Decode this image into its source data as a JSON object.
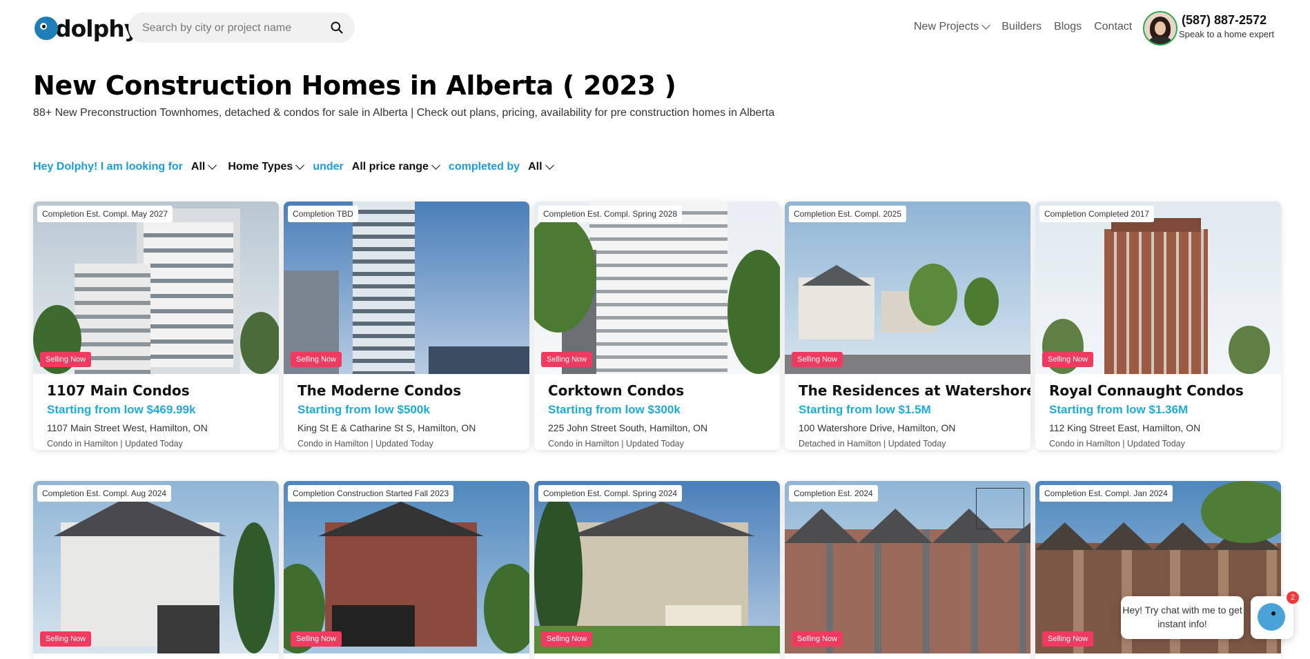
{
  "header": {
    "logo_text": "dolphy",
    "search_placeholder": "Search by city or project name",
    "nav": [
      {
        "label": "New Projects"
      },
      {
        "label": "Builders"
      },
      {
        "label": "Blogs"
      },
      {
        "label": "Contact"
      }
    ],
    "phone": "(587) 887-2572",
    "phone_sub": "Speak to a home expert"
  },
  "page": {
    "title": "New Construction Homes in Alberta ( 2023 )",
    "subtitle": "88+ New Preconstruction Townhomes, detached & condos for sale in Alberta | Check out plans, pricing, availability for pre construction homes in Alberta"
  },
  "filters": {
    "prefix": "Hey Dolphy! I am looking for",
    "type_value": "All",
    "home_types": "Home Types",
    "under": "under",
    "price_value": "All price range",
    "completed_by": "completed by",
    "completed_value": "All"
  },
  "cards": [
    {
      "completion": "Completion Est. Compl. May 2027",
      "status": "Selling Now",
      "title": "1107 Main Condos",
      "price": "Starting from low $469.99k",
      "address": "1107 Main Street West, Hamilton, ON",
      "meta": "Condo in Hamilton | Updated Today"
    },
    {
      "completion": "Completion TBD",
      "status": "Selling Now",
      "title": "The Moderne Condos",
      "price": "Starting from low $500k",
      "address": "King St E & Catharine St S, Hamilton, ON",
      "meta": "Condo in Hamilton | Updated Today"
    },
    {
      "completion": "Completion Est. Compl. Spring 2028",
      "status": "Selling Now",
      "title": "Corktown Condos",
      "price": "Starting from low $300k",
      "address": "225 John Street South, Hamilton, ON",
      "meta": "Condo in Hamilton | Updated Today"
    },
    {
      "completion": "Completion Est. Compl. 2025",
      "status": "Selling Now",
      "title": "The Residences at Watershore",
      "price": "Starting from low $1.5M",
      "address": "100 Watershore Drive, Hamilton, ON",
      "meta": "Detached in Hamilton | Updated Today"
    },
    {
      "completion": "Completion Completed 2017",
      "status": "Selling Now",
      "title": "Royal Connaught Condos",
      "price": "Starting from low $1.36M",
      "address": "112 King Street East, Hamilton, ON",
      "meta": "Condo in Hamilton | Updated Today"
    },
    {
      "completion": "Completion Est. Compl. Aug 2024",
      "status": "Selling Now"
    },
    {
      "completion": "Completion Construction Started Fall 2023",
      "status": "Selling Now"
    },
    {
      "completion": "Completion Est. Compl. Spring 2024",
      "status": "Selling Now"
    },
    {
      "completion": "Completion Est. 2024",
      "status": "Selling Now"
    },
    {
      "completion": "Completion Est. Compl. Jan 2024",
      "status": "Selling Now"
    }
  ],
  "chat": {
    "message": "Hey! Try chat with me to get instant info!",
    "unread_count": "2"
  },
  "colors": {
    "accent_blue": "#1e9cd7",
    "price_blue": "#1eabd8",
    "selling_badge": "#f03a5f"
  }
}
